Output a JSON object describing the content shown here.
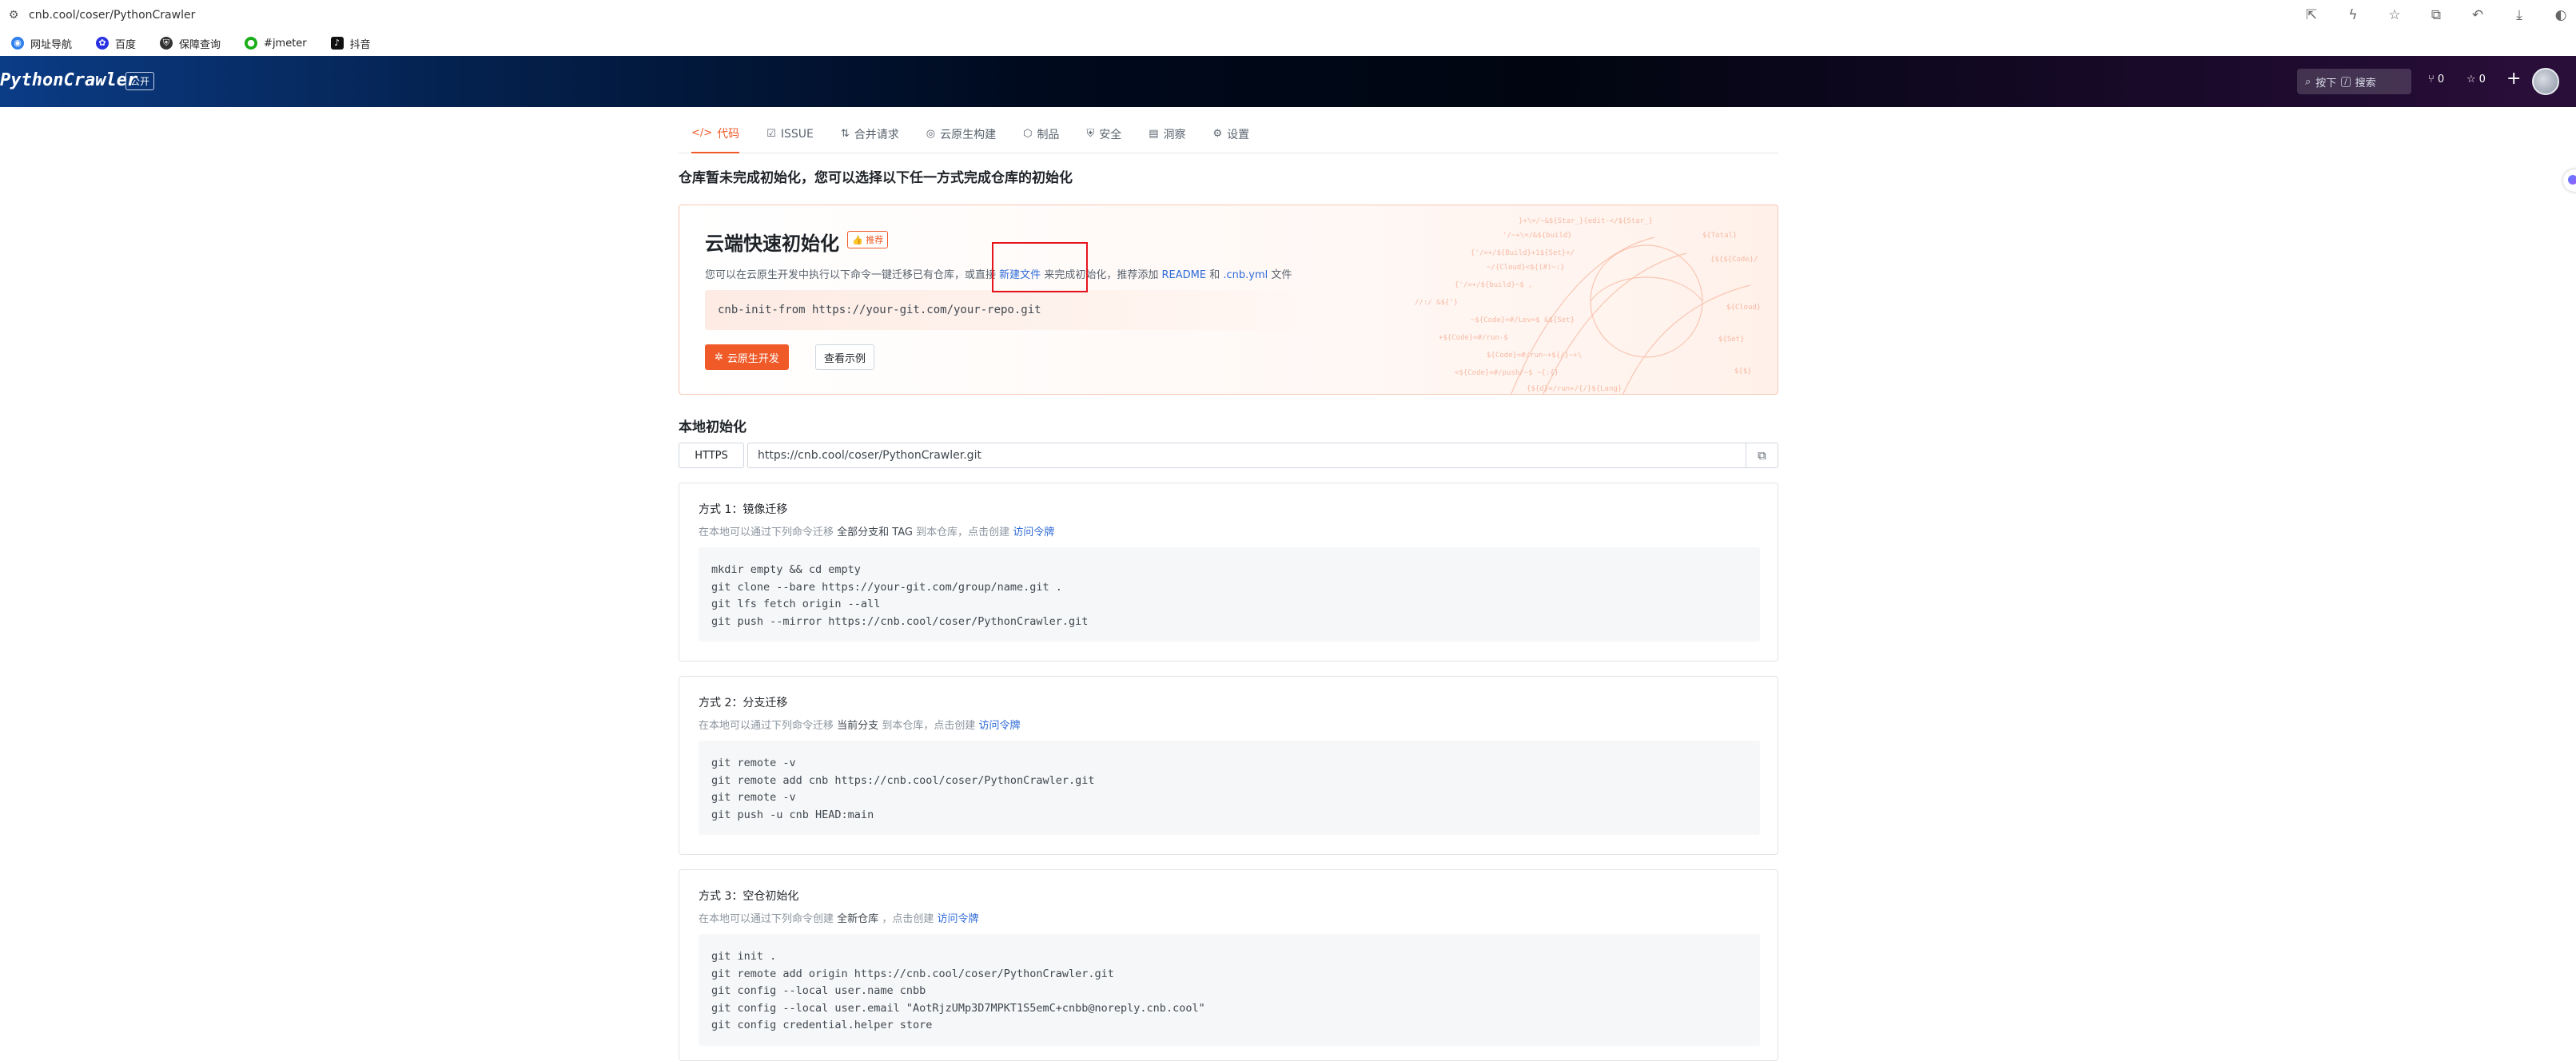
{
  "browser": {
    "url": "cnb.cool/coser/PythonCrawler",
    "bookmarks": [
      {
        "label": "网址导航",
        "icon": "globe-icon",
        "color": "#2f80ed"
      },
      {
        "label": "百度",
        "icon": "baidu-icon",
        "color": "#2932e1"
      },
      {
        "label": "保障查询",
        "icon": "shield-icon",
        "color": "#333333"
      },
      {
        "label": "#jmeter",
        "icon": "wechat-icon",
        "color": "#1aad19"
      },
      {
        "label": "抖音",
        "icon": "tiktok-icon",
        "color": "#111111"
      }
    ]
  },
  "header": {
    "repo_name": "PythonCrawler",
    "visibility": "公开",
    "search_key": "按下",
    "search_slash": "/",
    "search_label": "搜索",
    "forks": "0",
    "stars": "0",
    "plus": "+"
  },
  "tabs": [
    {
      "label": "代码",
      "icon": "</>",
      "active": true
    },
    {
      "label": "ISSUE",
      "icon": "☑",
      "active": false
    },
    {
      "label": "合并请求",
      "icon": "⇅",
      "active": false
    },
    {
      "label": "云原生构建",
      "icon": "◎",
      "active": false
    },
    {
      "label": "制品",
      "icon": "⬡",
      "active": false
    },
    {
      "label": "安全",
      "icon": "⛨",
      "active": false
    },
    {
      "label": "洞察",
      "icon": "▤",
      "active": false
    },
    {
      "label": "设置",
      "icon": "⚙",
      "active": false
    }
  ],
  "notice": "仓库暂未完成初始化，您可以选择以下任一方式完成仓库的初始化",
  "cloud": {
    "title": "云端快速初始化",
    "recommend_badge": "推荐",
    "desc_part1": "您可以在云原生开发中执行以下命令一键迁移已有仓库，或直接",
    "desc_link1": "新建文件",
    "desc_part2": "来完成初始化，推荐添加",
    "desc_link2": "README",
    "desc_part3": "和",
    "desc_link3": ".cnb.yml",
    "desc_part4": "文件",
    "command": "cnb-init-from https://your-git.com/your-repo.git",
    "primary_button": "云原生开发",
    "secondary_button": "查看示例"
  },
  "local": {
    "title": "本地初始化",
    "protocol": "HTTPS",
    "clone_url": "https://cnb.cool/coser/PythonCrawler.git"
  },
  "methods": [
    {
      "title": "方式 1：镜像迁移",
      "desc_part1": "在本地可以通过下列命令迁移",
      "desc_strong": "全部分支和 TAG",
      "desc_part2": "到本仓库，点击创建",
      "desc_link": "访问令牌",
      "code": [
        "mkdir empty && cd empty",
        "git clone --bare https://your-git.com/group/name.git .",
        "git lfs fetch origin --all",
        "git push --mirror https://cnb.cool/coser/PythonCrawler.git"
      ]
    },
    {
      "title": "方式 2：分支迁移",
      "desc_part1": "在本地可以通过下列命令迁移",
      "desc_strong": "当前分支",
      "desc_part2": "到本仓库，点击创建",
      "desc_link": "访问令牌",
      "code": [
        "git remote -v",
        "git remote add cnb https://cnb.cool/coser/PythonCrawler.git",
        "git remote -v",
        "git push -u cnb HEAD:main"
      ]
    },
    {
      "title": "方式 3：空仓初始化",
      "desc_part1": "在本地可以通过下列命令创建",
      "desc_strong": "全新仓库",
      "desc_part2": "，点击创建",
      "desc_link": "访问令牌",
      "code": [
        "git init .",
        "git remote add origin https://cnb.cool/coser/PythonCrawler.git",
        "git config --local user.name cnbb",
        "git config --local user.email \"AotRjzUMp3D7MPKT1S5emC+cnbb@noreply.cnb.cool\"",
        "git config credential.helper store"
      ]
    }
  ],
  "colors": {
    "accent": "#f05a28",
    "link": "#2f6bd8",
    "highlight_box": "#e5141c"
  }
}
